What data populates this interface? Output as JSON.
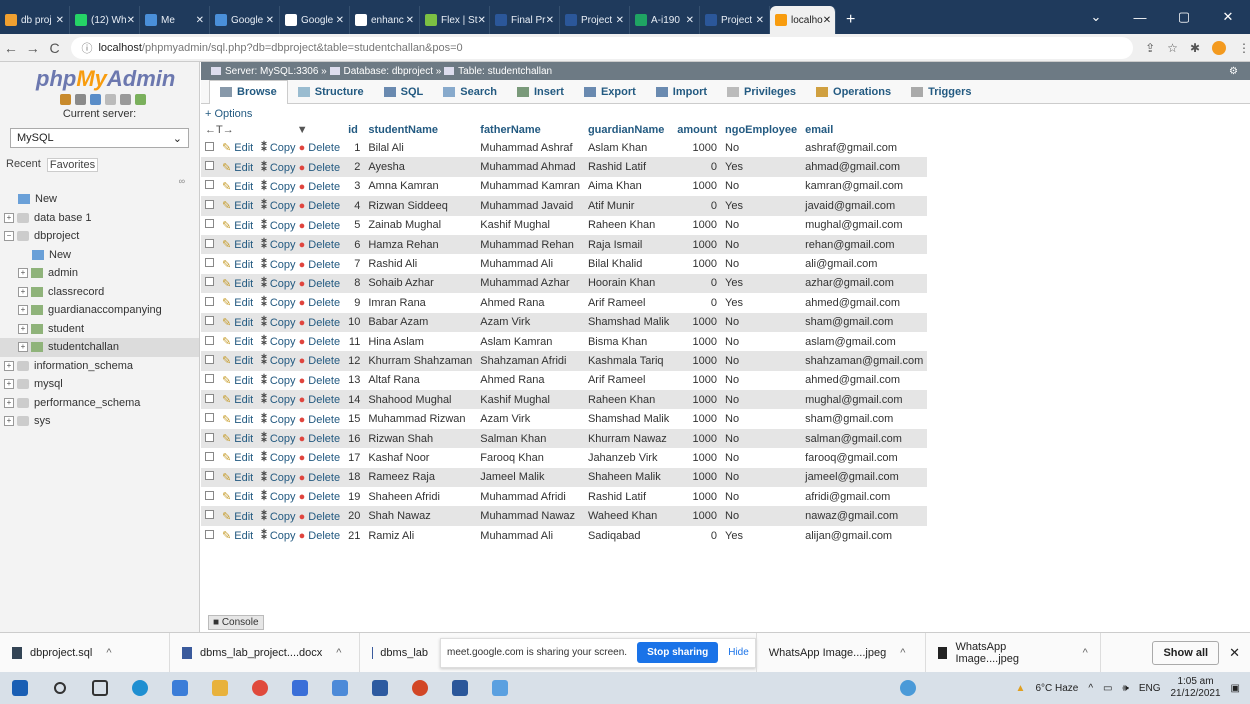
{
  "browser": {
    "tabs": [
      {
        "title": "db proj",
        "color": "#f0a030"
      },
      {
        "title": "(12) Wh",
        "color": "#25d366"
      },
      {
        "title": "Me",
        "color": "#4a8fd9"
      },
      {
        "title": "Google",
        "color": "#4a8fd9"
      },
      {
        "title": "Google",
        "color": "#ffffff"
      },
      {
        "title": "enhanc",
        "color": "#ffffff"
      },
      {
        "title": "Flex | St",
        "color": "#7cc043"
      },
      {
        "title": "Final Pr",
        "color": "#2b579a"
      },
      {
        "title": "Project",
        "color": "#2b579a"
      },
      {
        "title": "A-i190",
        "color": "#1fa463"
      },
      {
        "title": "Project",
        "color": "#2b579a"
      },
      {
        "title": "localho",
        "color": "#f89c0e",
        "active": true
      }
    ],
    "url_host": "localhost",
    "url_path": "/phpmyadmin/sql.php?db=dbproject&table=studentchallan&pos=0"
  },
  "sidebar": {
    "logo_php": "php",
    "logo_my": "My",
    "logo_admin": "Admin",
    "current_server_label": "Current server:",
    "server_select": "MySQL",
    "recent_label": "Recent",
    "favorites_label": "Favorites",
    "tree": [
      {
        "label": "New",
        "type": "new",
        "indent": 1
      },
      {
        "label": "data base 1",
        "type": "db",
        "indent": 0
      },
      {
        "label": "dbproject",
        "type": "db",
        "indent": 0,
        "open": true
      },
      {
        "label": "New",
        "type": "new",
        "indent": 2
      },
      {
        "label": "admin",
        "type": "table",
        "indent": 1
      },
      {
        "label": "classrecord",
        "type": "table",
        "indent": 1
      },
      {
        "label": "guardianaccompanying",
        "type": "table",
        "indent": 1
      },
      {
        "label": "student",
        "type": "table",
        "indent": 1
      },
      {
        "label": "studentchallan",
        "type": "table",
        "indent": 1,
        "selected": true
      },
      {
        "label": "information_schema",
        "type": "db",
        "indent": 0
      },
      {
        "label": "mysql",
        "type": "db",
        "indent": 0
      },
      {
        "label": "performance_schema",
        "type": "db",
        "indent": 0
      },
      {
        "label": "sys",
        "type": "db",
        "indent": 0
      }
    ]
  },
  "main": {
    "breadcrumb": {
      "server": "Server: MySQL:3306",
      "database": "Database: dbproject",
      "table": "Table: studentchallan"
    },
    "menu": [
      "Browse",
      "Structure",
      "SQL",
      "Search",
      "Insert",
      "Export",
      "Import",
      "Privileges",
      "Operations",
      "Triggers"
    ],
    "options_label": "+ Options",
    "columns": [
      "id",
      "studentName",
      "fatherName",
      "guardianName",
      "amount",
      "ngoEmployee",
      "email"
    ],
    "action_labels": {
      "edit": "Edit",
      "copy": "Copy",
      "delete": "Delete"
    },
    "rows": [
      [
        "1",
        "Bilal Ali",
        "Muhammad Ashraf",
        "Aslam Khan",
        "1000",
        "No",
        "ashraf@gmail.com"
      ],
      [
        "2",
        "Ayesha",
        "Muhammad Ahmad",
        "Rashid Latif",
        "0",
        "Yes",
        "ahmad@gmail.com"
      ],
      [
        "3",
        "Amna Kamran",
        "Muhammad Kamran",
        "Aima Khan",
        "1000",
        "No",
        "kamran@gmail.com"
      ],
      [
        "4",
        "Rizwan Siddeeq",
        "Muhammad Javaid",
        "Atif Munir",
        "0",
        "Yes",
        "javaid@gmail.com"
      ],
      [
        "5",
        "Zainab Mughal",
        "Kashif Mughal",
        "Raheen Khan",
        "1000",
        "No",
        "mughal@gmail.com"
      ],
      [
        "6",
        "Hamza Rehan",
        "Muhammad Rehan",
        "Raja Ismail",
        "1000",
        "No",
        "rehan@gmail.com"
      ],
      [
        "7",
        "Rashid Ali",
        "Muhammad Ali",
        "Bilal Khalid",
        "1000",
        "No",
        "ali@gmail.com"
      ],
      [
        "8",
        "Sohaib Azhar",
        "Muhammad Azhar",
        "Hoorain Khan",
        "0",
        "Yes",
        "azhar@gmail.com"
      ],
      [
        "9",
        "Imran Rana",
        "Ahmed Rana",
        "Arif Rameel",
        "0",
        "Yes",
        "ahmed@gmail.com"
      ],
      [
        "10",
        "Babar Azam",
        "Azam Virk",
        "Shamshad Malik",
        "1000",
        "No",
        "sham@gmail.com"
      ],
      [
        "11",
        "Hina Aslam",
        "Aslam Kamran",
        "Bisma Khan",
        "1000",
        "No",
        "aslam@gmail.com"
      ],
      [
        "12",
        "Khurram Shahzaman",
        "Shahzaman Afridi",
        "Kashmala Tariq",
        "1000",
        "No",
        "shahzaman@gmail.com"
      ],
      [
        "13",
        "Altaf Rana",
        "Ahmed Rana",
        "Arif Rameel",
        "1000",
        "No",
        "ahmed@gmail.com"
      ],
      [
        "14",
        "Shahood Mughal",
        "Kashif Mughal",
        "Raheen Khan",
        "1000",
        "No",
        "mughal@gmail.com"
      ],
      [
        "15",
        "Muhammad Rizwan",
        "Azam Virk",
        "Shamshad Malik",
        "1000",
        "No",
        "sham@gmail.com"
      ],
      [
        "16",
        "Rizwan Shah",
        "Salman Khan",
        "Khurram Nawaz",
        "1000",
        "No",
        "salman@gmail.com"
      ],
      [
        "17",
        "Kashaf Noor",
        "Farooq Khan",
        "Jahanzeb Virk",
        "1000",
        "No",
        "farooq@gmail.com"
      ],
      [
        "18",
        "Rameez Raja",
        "Jameel Malik",
        "Shaheen Malik",
        "1000",
        "No",
        "jameel@gmail.com"
      ],
      [
        "19",
        "Shaheen Afridi",
        "Muhammad Afridi",
        "Rashid Latif",
        "1000",
        "No",
        "afridi@gmail.com"
      ],
      [
        "20",
        "Shah Nawaz",
        "Muhammad Nawaz",
        "Waheed Khan",
        "1000",
        "No",
        "nawaz@gmail.com"
      ],
      [
        "21",
        "Ramiz Ali",
        "Muhammad Ali",
        "Sadiqabad",
        "0",
        "Yes",
        "alijan@gmail.com"
      ]
    ],
    "console_label": "Console"
  },
  "downloads": {
    "items": [
      "dbproject.sql",
      "dbms_lab_project....docx",
      "dbms_lab",
      "WhatsApp Image....jpeg",
      "WhatsApp Image....jpeg"
    ],
    "share_text": "meet.google.com is sharing your screen.",
    "stop_sharing": "Stop sharing",
    "hide": "Hide",
    "show_all": "Show all"
  },
  "taskbar": {
    "weather": "6°C Haze",
    "lang": "ENG",
    "time": "1:05 am",
    "date": "21/12/2021"
  }
}
